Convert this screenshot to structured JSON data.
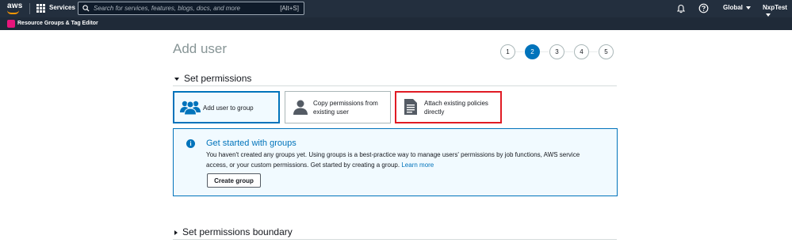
{
  "topnav": {
    "logo": "aws",
    "services_label": "Services",
    "search_placeholder": "Search for services, features, blogs, docs, and more",
    "search_shortcut": "[Alt+S]",
    "region": "Global",
    "account": "NxpTest",
    "icons": [
      "grid-icon",
      "search-icon",
      "bell-icon",
      "help-icon"
    ]
  },
  "subbar": {
    "label": "Resource Groups & Tag Editor",
    "icon_color": "#e7157b"
  },
  "page": {
    "title": "Add user",
    "steps": [
      "1",
      "2",
      "3",
      "4",
      "5"
    ],
    "active_step": "2"
  },
  "permissions": {
    "header": "Set permissions",
    "options": [
      {
        "label": "Add user to group",
        "selected": true,
        "icon": "users-icon"
      },
      {
        "label_line1": "Copy permissions from",
        "label_line2": "existing user",
        "selected": false,
        "icon": "user-icon"
      },
      {
        "label_line1": "Attach existing policies",
        "label_line2": "directly",
        "selected": false,
        "icon": "document-icon"
      }
    ]
  },
  "info": {
    "title": "Get started with groups",
    "text": "You haven't created any groups yet. Using groups is a best-practice way to manage users' permissions by job functions, AWS service access, or your custom permissions. Get started by creating a group.",
    "link": "Learn more",
    "button": "Create group"
  },
  "boundary": {
    "header": "Set permissions boundary"
  },
  "colors": {
    "nav_bg": "#232f3e",
    "accent": "#0073bb",
    "highlight": "#e01b24"
  }
}
